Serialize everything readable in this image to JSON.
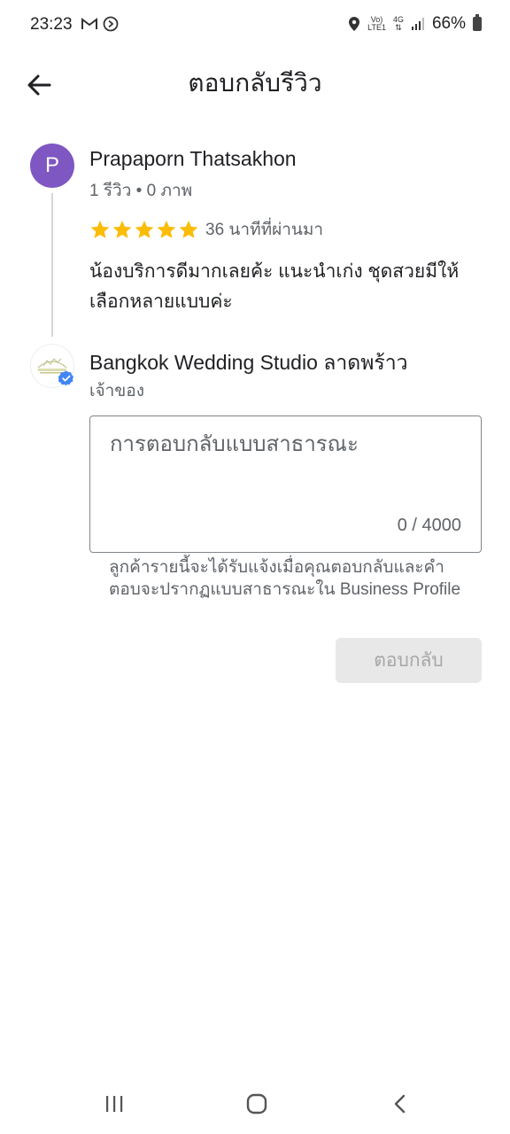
{
  "status_bar": {
    "time": "23:23",
    "network_top": "Vo)",
    "network_bottom": "LTE1",
    "data_top": "4G",
    "battery_percent": "66%",
    "icons": [
      "gmail-icon",
      "media-icon",
      "location-icon",
      "signal-icon",
      "battery-icon"
    ]
  },
  "app_bar": {
    "title": "ตอบกลับรีวิว",
    "back_icon": "arrow-left-icon"
  },
  "review": {
    "avatar_letter": "P",
    "avatar_color": "#7e57c2",
    "author_name": "Prapaporn Thatsakhon",
    "author_meta": "1 รีวิว • 0 ภาพ",
    "rating": 5,
    "star_color": "#fbbc04",
    "time_ago": "36 นาทีที่ผ่านมา",
    "text": "น้องบริการดีมากเลยค้ะ แนะนำเก่ง ชุดสวยมีให้เลือกหลายแบบค่ะ"
  },
  "business": {
    "name": "Bangkok Wedding Studio",
    "branch": " ลาดพร้าว",
    "role": "เจ้าของ",
    "verified_color": "#4285f4"
  },
  "reply": {
    "placeholder": "การตอบกลับแบบสาธารณะ",
    "value": "",
    "counter": "0 / 4000",
    "helper": "ลูกค้ารายนี้จะได้รับแจ้งเมื่อคุณตอบกลับและคำตอบจะปรากฏแบบสาธารณะใน Business Profile",
    "submit_label": "ตอบกลับ"
  },
  "nav": {
    "recent_icon": "recent-apps-icon",
    "home_icon": "home-icon",
    "back_icon": "nav-back-icon"
  }
}
